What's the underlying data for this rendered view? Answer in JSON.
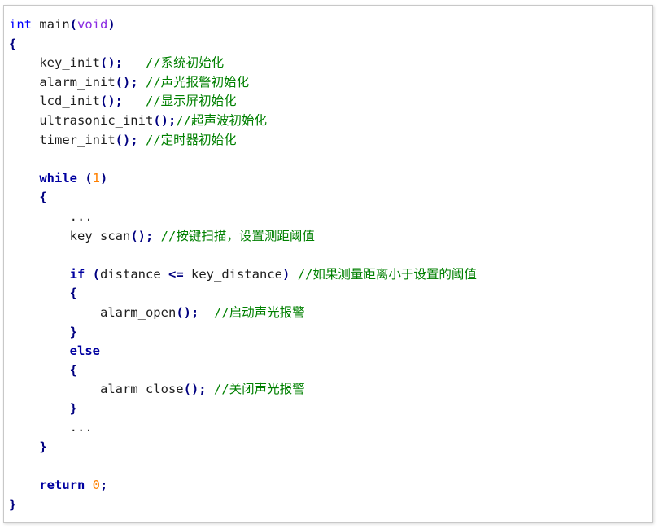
{
  "code_lines": [
    {
      "indent": 0,
      "segments": [
        {
          "cls": "kw",
          "text": "int"
        },
        {
          "cls": "fn",
          "text": " main"
        },
        {
          "cls": "pn",
          "text": "("
        },
        {
          "cls": "dim",
          "text": "void"
        },
        {
          "cls": "pn",
          "text": ")"
        }
      ]
    },
    {
      "indent": 0,
      "segments": [
        {
          "cls": "pn",
          "text": "{"
        }
      ]
    },
    {
      "indent": 4,
      "segments": [
        {
          "cls": "fn",
          "text": "key_init"
        },
        {
          "cls": "pn",
          "text": "();"
        },
        {
          "cls": "fn",
          "text": "   "
        },
        {
          "cls": "cm",
          "text": "//系统初始化"
        }
      ]
    },
    {
      "indent": 4,
      "segments": [
        {
          "cls": "fn",
          "text": "alarm_init"
        },
        {
          "cls": "pn",
          "text": "();"
        },
        {
          "cls": "fn",
          "text": " "
        },
        {
          "cls": "cm",
          "text": "//声光报警初始化"
        }
      ]
    },
    {
      "indent": 4,
      "segments": [
        {
          "cls": "fn",
          "text": "lcd_init"
        },
        {
          "cls": "pn",
          "text": "();"
        },
        {
          "cls": "fn",
          "text": "   "
        },
        {
          "cls": "cm",
          "text": "//显示屏初始化"
        }
      ]
    },
    {
      "indent": 4,
      "segments": [
        {
          "cls": "fn",
          "text": "ultrasonic_init"
        },
        {
          "cls": "pn",
          "text": "();"
        },
        {
          "cls": "cm",
          "text": "//超声波初始化"
        }
      ]
    },
    {
      "indent": 4,
      "segments": [
        {
          "cls": "fn",
          "text": "timer_init"
        },
        {
          "cls": "pn",
          "text": "();"
        },
        {
          "cls": "fn",
          "text": " "
        },
        {
          "cls": "cm",
          "text": "//定时器初始化"
        }
      ]
    },
    {
      "indent": 0,
      "segments": []
    },
    {
      "indent": 4,
      "segments": [
        {
          "cls": "kwb",
          "text": "while"
        },
        {
          "cls": "fn",
          "text": " "
        },
        {
          "cls": "pn",
          "text": "("
        },
        {
          "cls": "num",
          "text": "1"
        },
        {
          "cls": "pn",
          "text": ")"
        }
      ]
    },
    {
      "indent": 4,
      "segments": [
        {
          "cls": "pn",
          "text": "{"
        }
      ]
    },
    {
      "indent": 8,
      "segments": [
        {
          "cls": "fn",
          "text": "..."
        }
      ]
    },
    {
      "indent": 8,
      "segments": [
        {
          "cls": "fn",
          "text": "key_scan"
        },
        {
          "cls": "pn",
          "text": "();"
        },
        {
          "cls": "fn",
          "text": " "
        },
        {
          "cls": "cm",
          "text": "//按键扫描，设置测距阈值"
        }
      ]
    },
    {
      "indent": 0,
      "segments": []
    },
    {
      "indent": 8,
      "segments": [
        {
          "cls": "kwb",
          "text": "if"
        },
        {
          "cls": "fn",
          "text": " "
        },
        {
          "cls": "pn",
          "text": "("
        },
        {
          "cls": "fn",
          "text": "distance "
        },
        {
          "cls": "pn",
          "text": "<="
        },
        {
          "cls": "fn",
          "text": " key_distance"
        },
        {
          "cls": "pn",
          "text": ")"
        },
        {
          "cls": "fn",
          "text": " "
        },
        {
          "cls": "cm",
          "text": "//如果测量距离小于设置的阈值"
        }
      ]
    },
    {
      "indent": 8,
      "segments": [
        {
          "cls": "pn",
          "text": "{"
        }
      ]
    },
    {
      "indent": 12,
      "segments": [
        {
          "cls": "fn",
          "text": "alarm_open"
        },
        {
          "cls": "pn",
          "text": "();"
        },
        {
          "cls": "fn",
          "text": "  "
        },
        {
          "cls": "cm",
          "text": "//启动声光报警"
        }
      ]
    },
    {
      "indent": 8,
      "segments": [
        {
          "cls": "pn",
          "text": "}"
        }
      ]
    },
    {
      "indent": 8,
      "segments": [
        {
          "cls": "kwb",
          "text": "else"
        }
      ]
    },
    {
      "indent": 8,
      "segments": [
        {
          "cls": "pn",
          "text": "{"
        }
      ]
    },
    {
      "indent": 12,
      "segments": [
        {
          "cls": "fn",
          "text": "alarm_close"
        },
        {
          "cls": "pn",
          "text": "();"
        },
        {
          "cls": "fn",
          "text": " "
        },
        {
          "cls": "cm",
          "text": "//关闭声光报警"
        }
      ]
    },
    {
      "indent": 8,
      "segments": [
        {
          "cls": "pn",
          "text": "}"
        }
      ]
    },
    {
      "indent": 8,
      "segments": [
        {
          "cls": "fn",
          "text": "..."
        }
      ]
    },
    {
      "indent": 4,
      "segments": [
        {
          "cls": "pn",
          "text": "}"
        }
      ]
    },
    {
      "indent": 0,
      "segments": []
    },
    {
      "indent": 4,
      "segments": [
        {
          "cls": "kwb",
          "text": "return"
        },
        {
          "cls": "fn",
          "text": " "
        },
        {
          "cls": "num",
          "text": "0"
        },
        {
          "cls": "pn",
          "text": ";"
        }
      ]
    },
    {
      "indent": 0,
      "segments": [
        {
          "cls": "pn",
          "text": "}"
        }
      ]
    }
  ],
  "colors": {
    "keyword": "#0000ff",
    "keyword_bold": "#0000a0",
    "punctuation": "#000080",
    "number": "#ff8000",
    "comment": "#008000",
    "type_void": "#8a2be2",
    "text": "#1e1e1e"
  }
}
